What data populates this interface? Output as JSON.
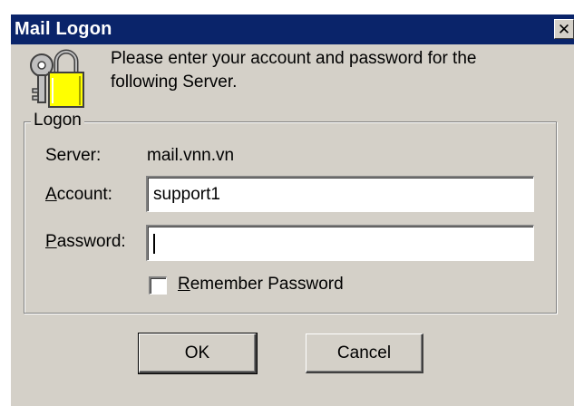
{
  "window": {
    "title": "Mail Logon",
    "close_glyph": "✕"
  },
  "header": {
    "icon": "keys-lock-icon",
    "message": "Please enter your account and password for the following Server."
  },
  "logon_group": {
    "label": "Logon",
    "server_label": "Server:",
    "server_value": "mail.vnn.vn",
    "account_label_accel": "A",
    "account_label_rest": "ccount:",
    "account_value": "support1",
    "password_label_accel": "P",
    "password_label_rest": "assword:",
    "password_value": "",
    "remember_accel": "R",
    "remember_rest": "emember Password",
    "remember_checked": false
  },
  "buttons": {
    "ok_label": "OK",
    "cancel_label": "Cancel"
  },
  "colors": {
    "titlebar": "#0a246a",
    "dialog_bg": "#d4d0c8"
  }
}
